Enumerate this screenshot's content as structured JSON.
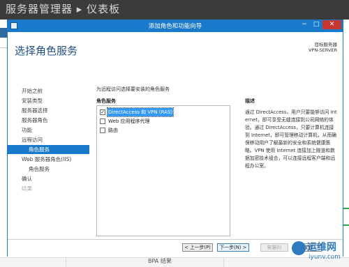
{
  "background": {
    "title": "服务器管理器 ▸ 仪表板",
    "bpa_label": "BPA 结果"
  },
  "window": {
    "title": "添加角色和功能向导",
    "controls": {
      "minimize": "−",
      "maximize": "□",
      "close": "✕"
    }
  },
  "header": {
    "page_title": "选择角色服务",
    "destination_label": "目标服务器",
    "destination_server": "VPN-SERVER"
  },
  "nav": {
    "items": [
      {
        "label": "开始之前",
        "state": "normal"
      },
      {
        "label": "安装类型",
        "state": "normal"
      },
      {
        "label": "服务器选择",
        "state": "normal"
      },
      {
        "label": "服务器角色",
        "state": "normal"
      },
      {
        "label": "功能",
        "state": "normal"
      },
      {
        "label": "远程访问",
        "state": "normal"
      },
      {
        "label": "角色服务",
        "state": "active"
      },
      {
        "label": "Web 服务器角色(IIS)",
        "state": "normal"
      },
      {
        "label": "角色服务",
        "state": "normal"
      },
      {
        "label": "确认",
        "state": "normal"
      },
      {
        "label": "结果",
        "state": "disabled"
      }
    ]
  },
  "main": {
    "instruction": "为远程访问选择要安装的角色服务",
    "roles_label": "角色服务",
    "roles": [
      {
        "label": "DirectAccess 和 VPN (RAS)",
        "checked": true,
        "selected": true
      },
      {
        "label": "Web 应用程序代理",
        "checked": false,
        "selected": false
      },
      {
        "label": "路由",
        "checked": false,
        "selected": false
      }
    ],
    "description_title": "描述",
    "description": "通过 DirectAccess，用户只要能够访问 Internet，即可享受无缝连接到公司网络的体验。通过 DirectAccess，只要计算机连接到 Internet，即可管理移动计算机，从而确保移动用户了解最新的安全和系统健康策略。VPN 使用 Internet 连接加上隧道和数据加密技术组合，可以连接远程客户端和远程办公室。"
  },
  "footer": {
    "prev": "< 上一步(P)",
    "next": "下一步(N) >",
    "install": "安装(I)",
    "cancel": "取消"
  },
  "watermark": {
    "name": "运维网",
    "url": "iyunv.com"
  }
}
